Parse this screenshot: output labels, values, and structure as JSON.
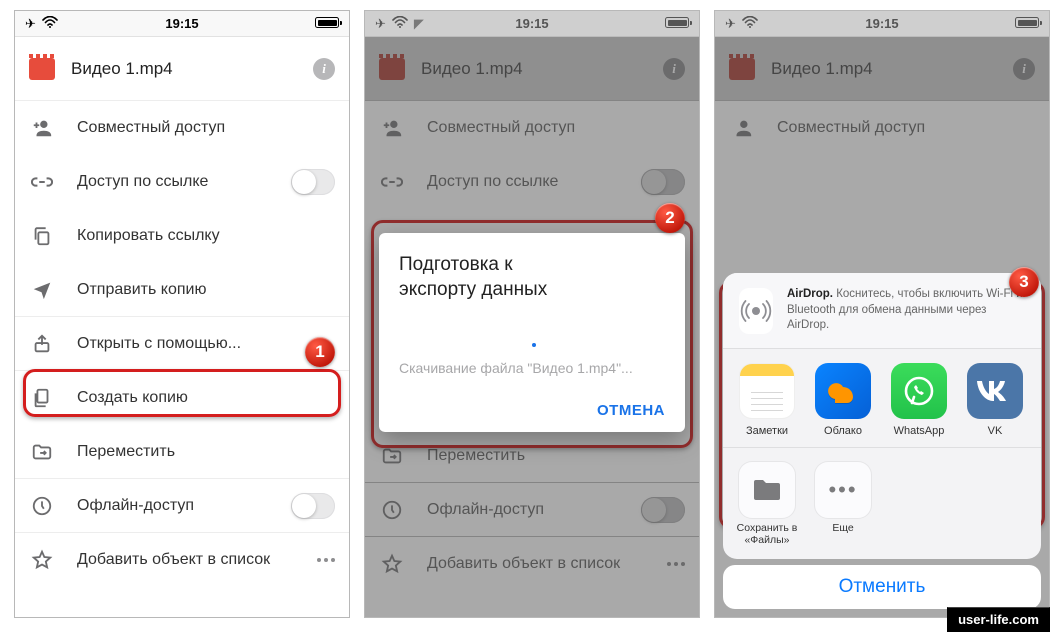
{
  "status": {
    "time": "19:15"
  },
  "header": {
    "title": "Видео 1.mp4"
  },
  "menu": {
    "share": "Совместный доступ",
    "linkaccess": "Доступ по ссылке",
    "copylink": "Копировать ссылку",
    "sendcopy": "Отправить копию",
    "openwith": "Открыть с помощью...",
    "makecopy": "Создать копию",
    "move": "Переместить",
    "offline": "Офлайн-доступ",
    "addtolist": "Добавить объект в список"
  },
  "dialog": {
    "title1": "Подготовка к",
    "title2": "экспорту данных",
    "sub": "Скачивание файла \"Видео 1.mp4\"...",
    "cancel": "ОТМЕНА"
  },
  "airdrop": {
    "bold": "AirDrop.",
    "text": " Коснитесь, чтобы включить Wi-Fi и Bluetooth для обмена данными через AirDrop."
  },
  "apps": {
    "notes": "Заметки",
    "cloud": "Облако",
    "whatsapp": "WhatsApp",
    "vk": "VK"
  },
  "actions": {
    "savefiles1": "Сохранить в",
    "savefiles2": "«Файлы»",
    "more": "Еще"
  },
  "cancel": "Отменить",
  "badges": {
    "b1": "1",
    "b2": "2",
    "b3": "3"
  },
  "watermark": "user-life.com"
}
